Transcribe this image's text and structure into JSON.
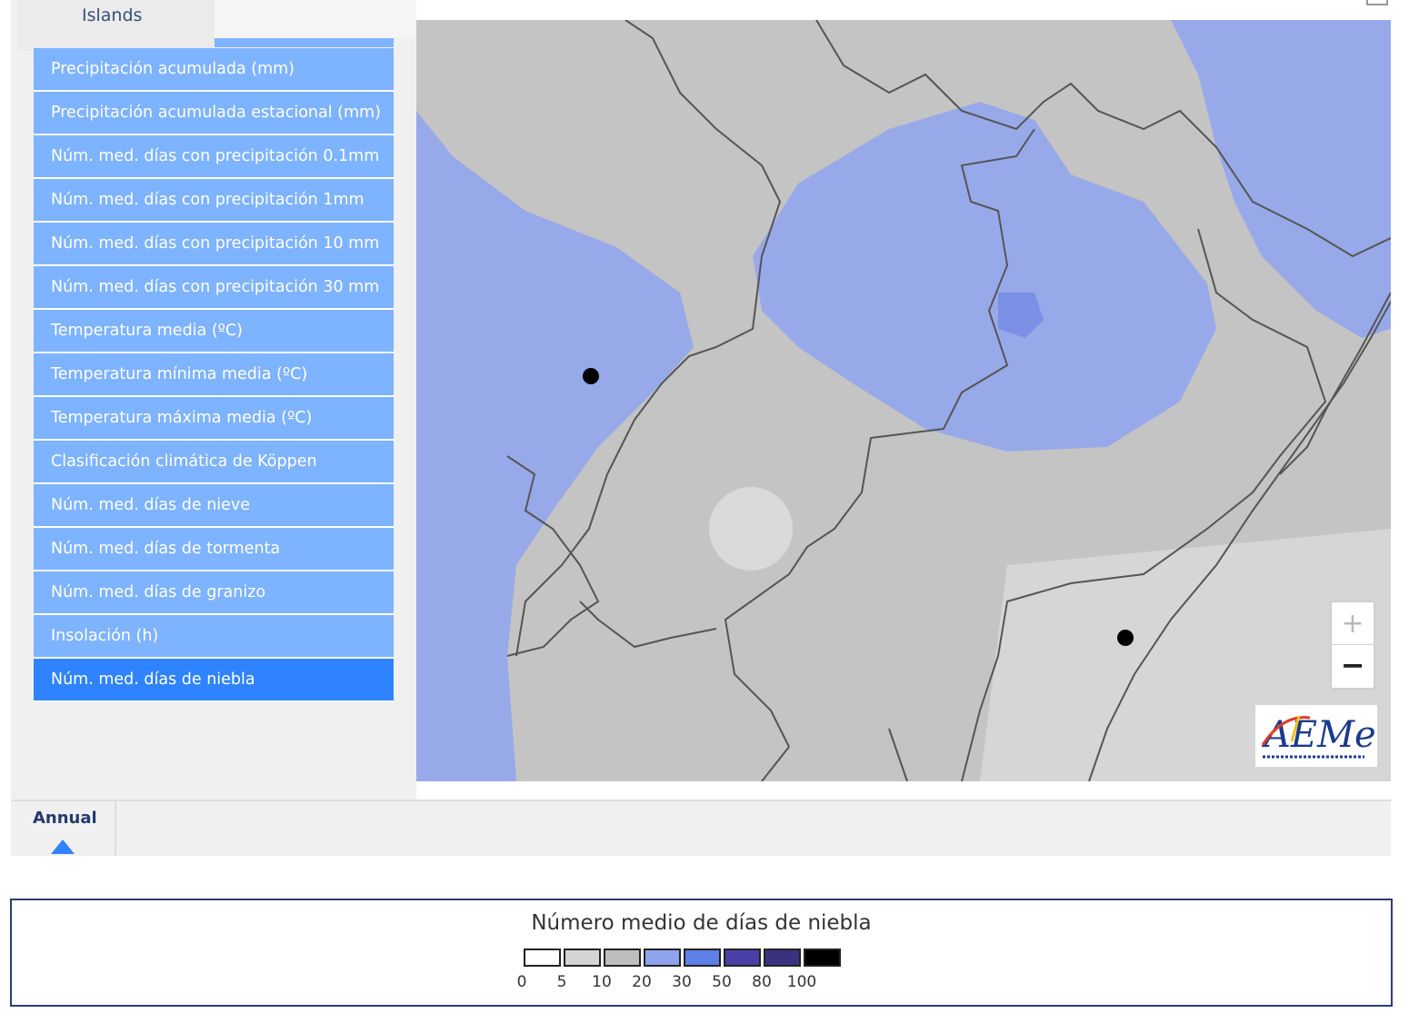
{
  "sidebar": {
    "tab_label": "Islands",
    "items": [
      {
        "label": "Precipitación acumulada (mm)",
        "active": false
      },
      {
        "label": "Precipitación acumulada estacional (mm)",
        "active": false
      },
      {
        "label": "Núm. med. días con precipitación 0.1mm",
        "active": false
      },
      {
        "label": "Núm. med. días con precipitación 1mm",
        "active": false
      },
      {
        "label": "Núm. med. días con precipitación 10 mm",
        "active": false
      },
      {
        "label": "Núm. med. días con precipitación 30 mm",
        "active": false
      },
      {
        "label": "Temperatura media (ºC)",
        "active": false
      },
      {
        "label": "Temperatura mínima media (ºC)",
        "active": false
      },
      {
        "label": "Temperatura máxima media (ºC)",
        "active": false
      },
      {
        "label": "Clasificación climática de Köppen",
        "active": false
      },
      {
        "label": "Núm. med. días de nieve",
        "active": false
      },
      {
        "label": "Núm. med. días de tormenta",
        "active": false
      },
      {
        "label": "Núm. med. días de granizo",
        "active": false
      },
      {
        "label": "Insolación (h)",
        "active": false
      },
      {
        "label": "Núm. med. días de niebla",
        "active": true
      }
    ]
  },
  "map": {
    "zoom_in": "+",
    "zoom_out": "−",
    "logo_text": "AEMet",
    "logo_subtext": "Agencia Estatal de Meteorología",
    "colors": {
      "base": "#c4c4c4",
      "light_zone": "#d6d6d6",
      "pale_zone": "#dadada",
      "blue_zone": "#98a9e9",
      "dark_blue_patch": "#7b8fe6",
      "border_lines": "#555555"
    }
  },
  "tabs": {
    "annual_label": "Annual"
  },
  "legend": {
    "title": "Número medio de días de niebla",
    "swatches": [
      "#ffffff",
      "#d4d4d4",
      "#bdbdbd",
      "#8fa3ef",
      "#5f7ee6",
      "#4a3fa6",
      "#3a327e",
      "#000000"
    ],
    "ticks": [
      "0",
      "5",
      "10",
      "20",
      "30",
      "50",
      "80",
      "100"
    ]
  }
}
